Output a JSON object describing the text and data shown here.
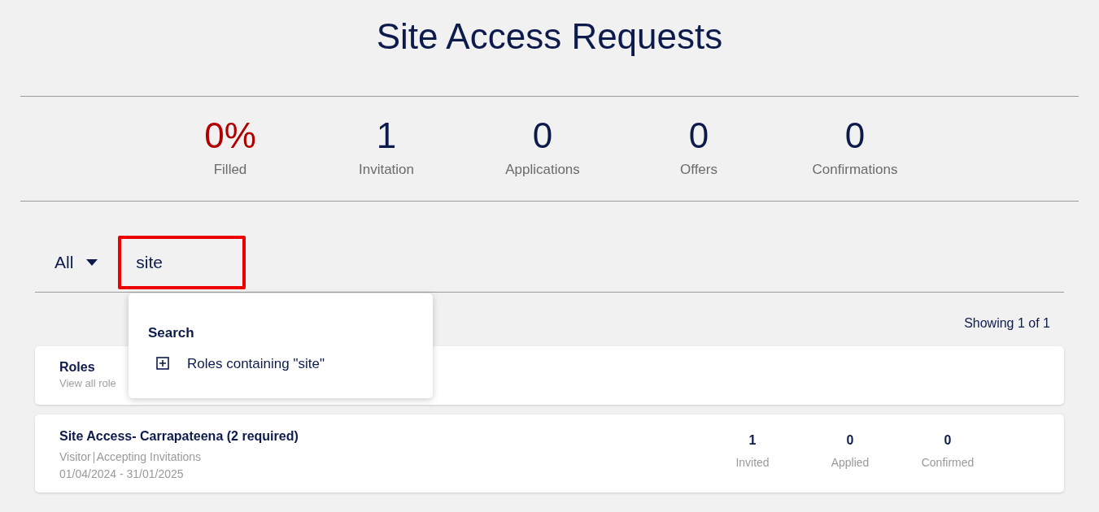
{
  "title": "Site Access Requests",
  "stats": [
    {
      "value": "0%",
      "label": "Filled",
      "color": "#b00000"
    },
    {
      "value": "1",
      "label": "Invitation",
      "color": "#0d1b4c"
    },
    {
      "value": "0",
      "label": "Applications",
      "color": "#0d1b4c"
    },
    {
      "value": "0",
      "label": "Offers",
      "color": "#0d1b4c"
    },
    {
      "value": "0",
      "label": "Confirmations",
      "color": "#0d1b4c"
    }
  ],
  "filter": {
    "value": "All"
  },
  "search": {
    "value": "site"
  },
  "suggestions": {
    "heading": "Search",
    "items": [
      {
        "label": "Roles containing \"site\""
      }
    ]
  },
  "showing": "Showing 1 of 1",
  "roles_card": {
    "title": "Roles",
    "subtitle": "View all role"
  },
  "requests": [
    {
      "title": "Site Access- Carrapateena (2 required)",
      "type": "Visitor",
      "status": "Accepting Invitations",
      "dates": "01/04/2024 - 31/01/2025",
      "counts": [
        {
          "value": "1",
          "label": "Invited"
        },
        {
          "value": "0",
          "label": "Applied"
        },
        {
          "value": "0",
          "label": "Confirmed"
        }
      ]
    }
  ]
}
